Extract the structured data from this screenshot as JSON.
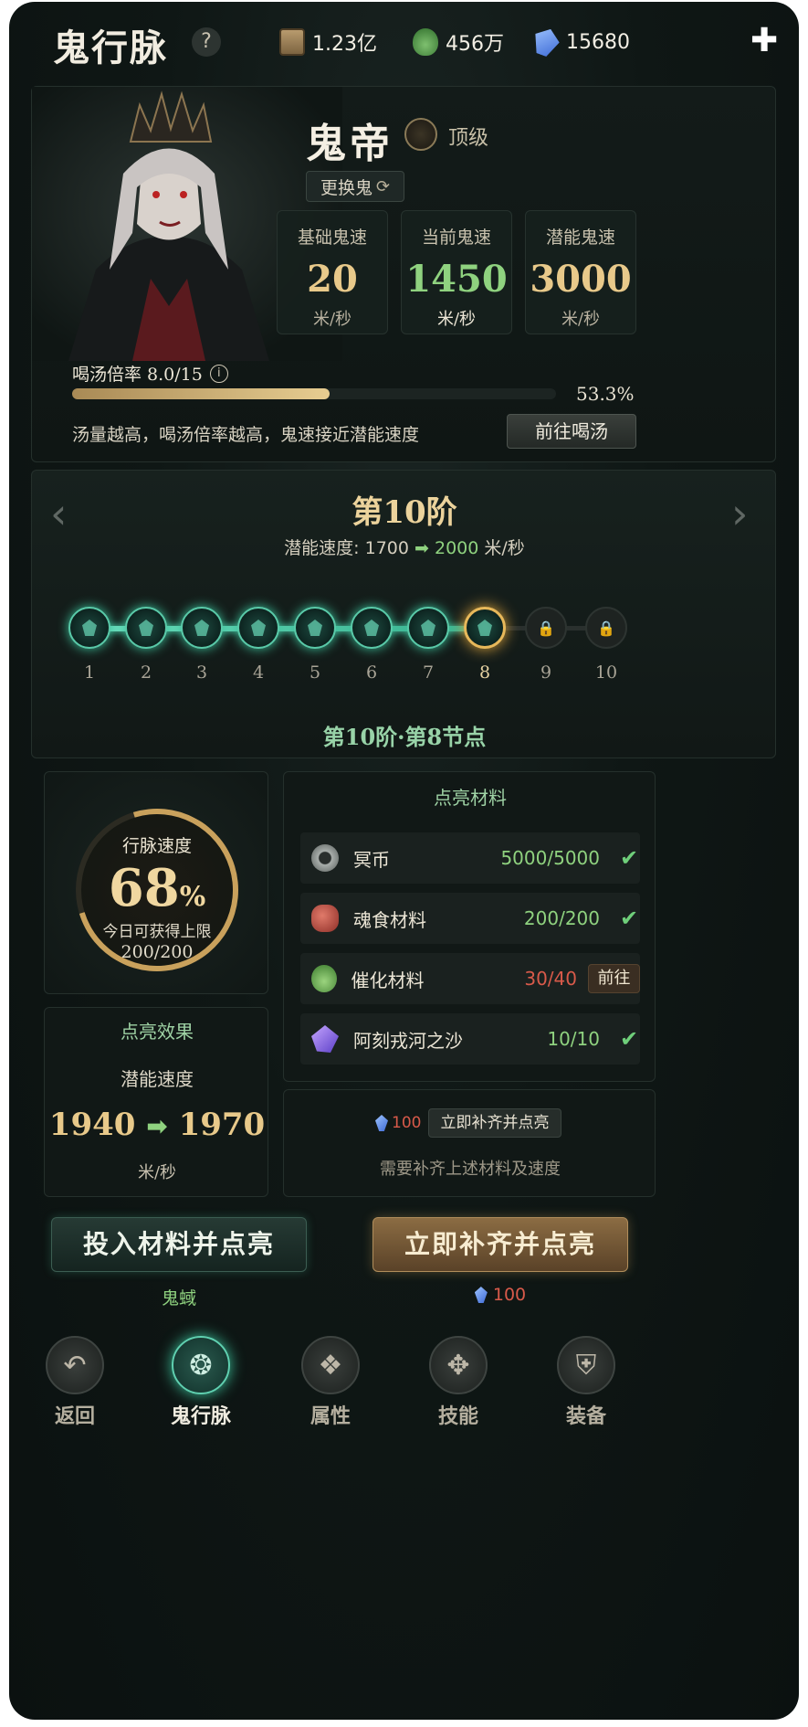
{
  "header": {
    "title": "鬼行脉",
    "help_icon": "question-icon",
    "resources": [
      {
        "icon": "scroll-icon",
        "value": "1.23亿"
      },
      {
        "icon": "pouch-icon",
        "value": "456万"
      },
      {
        "icon": "crystal-icon",
        "value": "15680"
      }
    ],
    "add_icon": "plus-icon"
  },
  "hero": {
    "name": "鬼帝",
    "rank_icon": "rank-emblem-icon",
    "rank": "顶级",
    "swap_label": "更换鬼",
    "stats": [
      {
        "label": "基础鬼速",
        "value": "20",
        "unit": "米/秒"
      },
      {
        "label": "当前鬼速",
        "value": "1450",
        "unit": "米/秒"
      },
      {
        "label": "潜能鬼速",
        "value": "3000",
        "unit": "米/秒"
      }
    ],
    "soup": {
      "label": "喝汤倍率 8.0/15",
      "progress": 0.533,
      "percent_text": "53.3%",
      "hint": "汤量越高，喝汤倍率越高，鬼速接近潜能速度",
      "button": "前往喝汤"
    }
  },
  "tier": {
    "title": "第10阶",
    "sub_label": "潜能速度:",
    "from": "1700",
    "arrow": "➡",
    "to": "2000",
    "unit": "米/秒",
    "nodes": [
      "1",
      "2",
      "3",
      "4",
      "5",
      "6",
      "7",
      "8",
      "9",
      "10"
    ],
    "current_node": 8,
    "node_title": "第10阶·第8节点"
  },
  "pulse": {
    "label": "行脉速度",
    "value": "68",
    "percent": "%",
    "progress": 0.68,
    "note": "今日可获得上限",
    "count": "200/200"
  },
  "effect": {
    "title": "点亮效果",
    "sub": "潜能速度",
    "from": "1940",
    "arrow": "➡",
    "to": "1970",
    "unit": "米/秒"
  },
  "materials": {
    "title": "点亮材料",
    "items": [
      {
        "icon": "coin-icon",
        "name": "冥币",
        "count": "5000/5000",
        "status": "ok"
      },
      {
        "icon": "meat-icon",
        "name": "魂食材料",
        "count": "200/200",
        "status": "ok"
      },
      {
        "icon": "pouch-icon",
        "name": "催化材料",
        "count": "30/40",
        "status": "lack"
      },
      {
        "icon": "sand-crystal-icon",
        "name": "阿刻戎河之沙",
        "count": "10/10",
        "status": "ok"
      }
    ],
    "goto_label": "前往"
  },
  "refill": {
    "cost": "100",
    "button": "立即补齐并点亮",
    "note": "需要补齐上述材料及速度"
  },
  "actions": {
    "invest": "投入材料并点亮",
    "invest_sub": "鬼蜮",
    "instant": "立即补齐并点亮",
    "instant_cost": "100"
  },
  "nav": [
    {
      "icon": "return-arrow-icon",
      "label": "返回",
      "active": false
    },
    {
      "icon": "ghost-pulse-icon",
      "label": "鬼行脉",
      "active": true
    },
    {
      "icon": "attribute-icon",
      "label": "属性",
      "active": false
    },
    {
      "icon": "skill-icon",
      "label": "技能",
      "active": false
    },
    {
      "icon": "equipment-icon",
      "label": "装备",
      "active": false
    }
  ],
  "colors": {
    "accent_green": "#8fd27f",
    "accent_gold": "#e8c98a",
    "warn_red": "#d85a4a",
    "glow_teal": "#59c9a8"
  }
}
